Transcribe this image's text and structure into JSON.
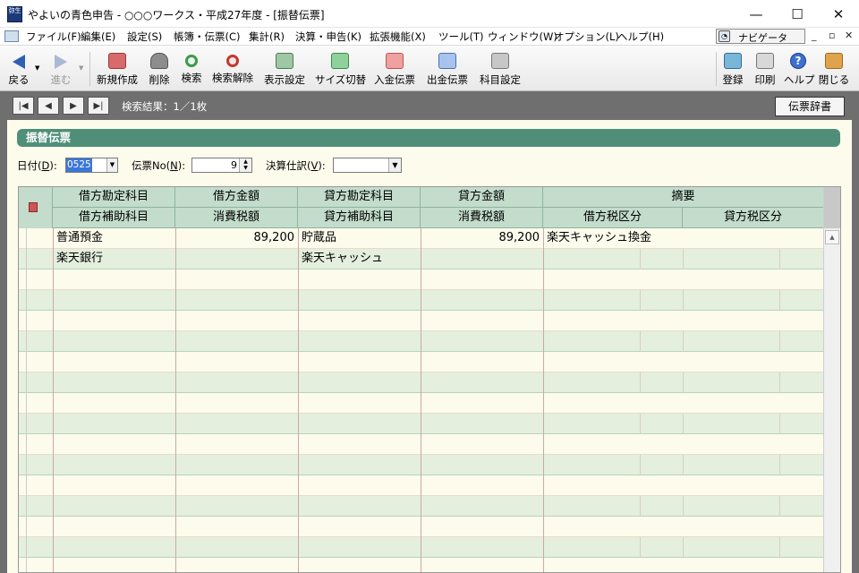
{
  "window": {
    "logo_text": "弥生",
    "title": "やよいの青色申告 - ○○○ワークス・平成27年度 - [振替伝票]",
    "minimize": "—",
    "maximize": "☐",
    "close": "✕"
  },
  "menu": {
    "items": [
      "ファイル(F)",
      "編集(E)",
      "設定(S)",
      "帳簿・伝票(C)",
      "集計(R)",
      "決算・申告(K)",
      "拡張機能(X)",
      "ツール(T)",
      "ウィンドウ(W)",
      "オプション(L)",
      "ヘルプ(H)"
    ],
    "navigator": "ナビゲータ",
    "mdi_min": "_",
    "mdi_restore": "▫",
    "mdi_close": "✕"
  },
  "toolbar": {
    "back": "戻る",
    "forward": "進む",
    "new": "新規作成",
    "delete": "削除",
    "search": "検索",
    "search_clear": "検索解除",
    "display_settings": "表示設定",
    "size_toggle": "サイズ切替",
    "receipt_voucher": "入金伝票",
    "payment_voucher": "出金伝票",
    "account_settings": "科目設定",
    "register": "登録",
    "print": "印刷",
    "help": "ヘルプ",
    "close": "閉じる"
  },
  "subbar": {
    "first": "|◀",
    "prev": "◀",
    "next": "▶",
    "last": "▶|",
    "search_result": "検索結果：1／1枚",
    "dictionary_button": "伝票辞書"
  },
  "section": {
    "title": "振替伝票"
  },
  "form": {
    "date_label": "日付(",
    "date_key": "D",
    "date_label_end": "):",
    "date_value": "0525",
    "voucher_label": "伝票No(",
    "voucher_key": "N",
    "voucher_label_end": "):",
    "voucher_value": "9",
    "closing_label": "決算仕訳(",
    "closing_key": "V",
    "closing_label_end": "):",
    "closing_value": ""
  },
  "grid": {
    "headers_top": [
      "借方勘定科目",
      "借方金額",
      "貸方勘定科目",
      "貸方金額",
      "摘要"
    ],
    "headers_bottom": [
      "借方補助科目",
      "消費税額",
      "貸方補助科目",
      "消費税額",
      "借方税区分",
      "貸方税区分"
    ],
    "entries": [
      {
        "debit_account": "普通預金",
        "debit_amount": "89,200",
        "credit_account": "貯蔵品",
        "credit_amount": "89,200",
        "summary": "楽天キャッシュ換金",
        "debit_sub": "楽天銀行",
        "debit_tax": "",
        "credit_sub": "楽天キャッシュ",
        "credit_tax": "",
        "debit_tax_class": "",
        "credit_tax_class": ""
      }
    ]
  },
  "colors": {
    "header_green": "#4f8f79",
    "grid_header": "#c3dccb",
    "row_cream": "#fdfbec",
    "row_green": "#e4efde",
    "selection_blue": "#3b77d6"
  },
  "icons": {
    "back": "back-arrow-icon",
    "forward": "forward-arrow-icon",
    "new": "new-document-icon",
    "delete": "delete-icon",
    "search": "magnifier-icon",
    "search_clear": "magnifier-clear-icon",
    "display_settings": "display-settings-icon",
    "size_toggle": "size-toggle-icon",
    "receipt_voucher": "receipt-voucher-icon",
    "payment_voucher": "payment-voucher-icon",
    "account_settings": "account-settings-icon",
    "register": "register-icon",
    "print": "printer-icon",
    "help": "help-icon",
    "close": "exit-door-icon"
  }
}
